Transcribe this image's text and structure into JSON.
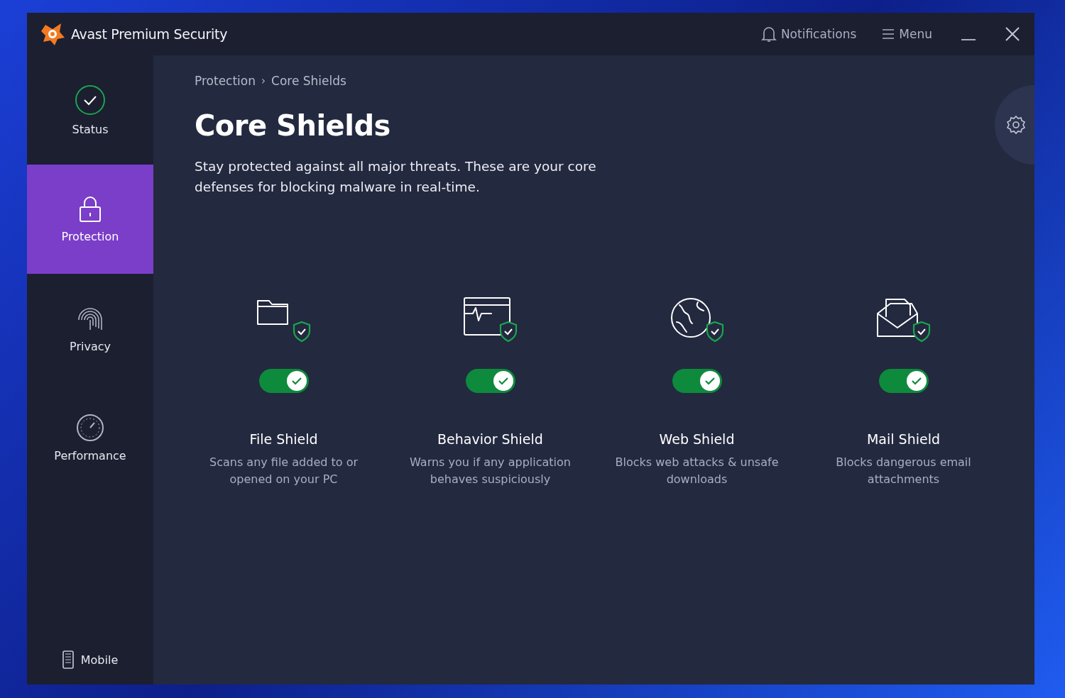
{
  "window": {
    "title": "Avast Premium Security",
    "notifications": "Notifications",
    "menu": "Menu"
  },
  "sidebar": {
    "items": [
      {
        "kind": "status",
        "label": "Status",
        "selected": false
      },
      {
        "kind": "protection",
        "label": "Protection",
        "selected": true
      },
      {
        "kind": "privacy",
        "label": "Privacy",
        "selected": false
      },
      {
        "kind": "performance",
        "label": "Performance",
        "selected": false
      }
    ],
    "mobile": "Mobile"
  },
  "breadcrumb": [
    "Protection",
    "Core Shields"
  ],
  "breadcrumb_separator": "›",
  "title": "Core Shields",
  "description": "Stay protected against all major threats. These are your core defenses for blocking malware in real-time.",
  "shields": [
    {
      "kind": "file",
      "name": "File Shield",
      "description": "Scans any file added to or opened on your PC",
      "on": true
    },
    {
      "kind": "behavior",
      "name": "Behavior Shield",
      "description": "Warns you if any application behaves suspiciously",
      "on": true
    },
    {
      "kind": "web",
      "name": "Web Shield",
      "description": "Blocks web attacks & unsafe downloads",
      "on": true
    },
    {
      "kind": "mail",
      "name": "Mail Shield",
      "description": "Blocks dangerous email attachments",
      "on": true
    }
  ]
}
